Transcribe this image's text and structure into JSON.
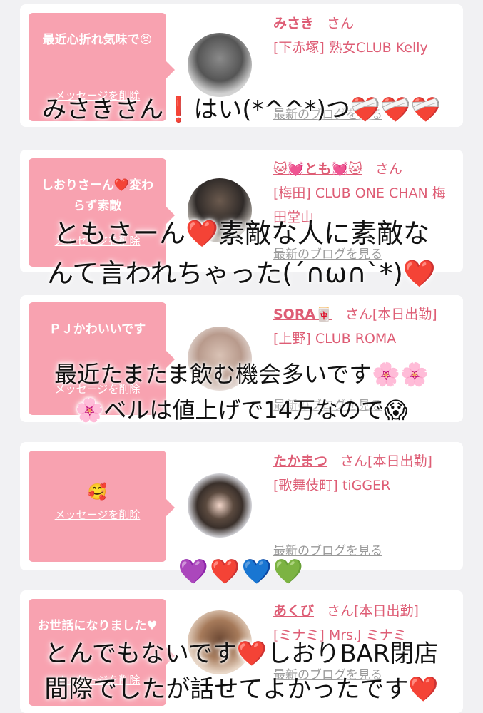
{
  "cards": [
    {
      "message": "最近心折れ気味で😣",
      "delete_label": "メッセージを削除",
      "name": "みさき",
      "honorific": "さん",
      "status": "",
      "shop": "[下赤塚] 熟女CLUB Kelly",
      "blog_label": "最新のブログを見る"
    },
    {
      "message": "しおりさーん❤️変わらず素敵",
      "delete_label": "メッセージを削除",
      "name": "🐱💓とも💓🐱",
      "honorific": "さん",
      "status": "",
      "shop": "[梅田] CLUB ONE CHAN 梅田堂山",
      "blog_label": "最新のブログを見る"
    },
    {
      "message": "ＰＪかわいいです",
      "delete_label": "メッセージを削除",
      "name": "SORA🀄",
      "honorific": "さん",
      "status": "[本日出勤]",
      "shop": "[上野] CLUB ROMA",
      "blog_label": "最新のブログを見る"
    },
    {
      "message": "🥰",
      "delete_label": "メッセージを削除",
      "name": "たかまつ",
      "honorific": "さん",
      "status": "[本日出勤]",
      "shop": "[歌舞伎町] tiGGER",
      "blog_label": "最新のブログを見る"
    },
    {
      "message": "お世話になりました♥",
      "delete_label": "メッセージを削除",
      "name": "あくび",
      "honorific": "さん",
      "status": "[本日出勤]",
      "shop": "[ミナミ] Mrs.J ミナミ",
      "blog_label": "最新のブログを見る"
    }
  ],
  "overlays": {
    "caption1": "みさきさん❗️はい(*^^*)つ❤️‍🩹❤️‍🩹❤️‍🩹",
    "caption2_line1": "ともさーん❤️素敵な人に素敵な",
    "caption2_line2": "んて言われちゃった(´∩ω∩`*)❤️",
    "caption3_line1": "最近たまたま飲む機会多いです🌸🌸",
    "caption3_line2": "🌸ベルは値上げで14万なので😱",
    "hearts": "💜❤️💙💚",
    "caption5_line1": "とんでもないです❤️しおりBAR閉店",
    "caption5_line2": "間際でしたが話せてよかったです❤️"
  },
  "colors": {
    "bubble": "#f8a2b0",
    "name_link": "#de5d75",
    "blog_link": "#9a9a9a",
    "page_bg": "#f1f1f3"
  }
}
